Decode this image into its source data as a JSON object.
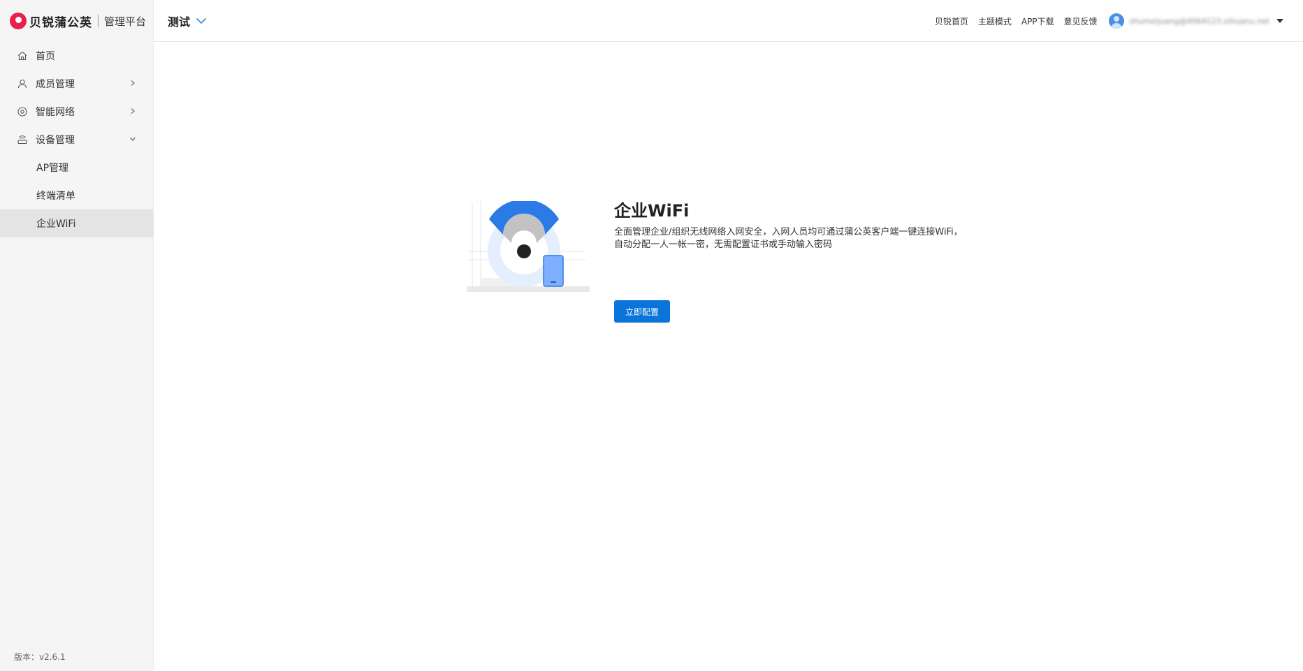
{
  "brand": {
    "name": "贝锐蒲公英",
    "subtitle": "管理平台"
  },
  "sidebar": {
    "items": [
      {
        "label": "首页",
        "icon": "home-icon"
      },
      {
        "label": "成员管理",
        "icon": "user-icon"
      },
      {
        "label": "智能网络",
        "icon": "network-icon"
      },
      {
        "label": "设备管理",
        "icon": "router-icon"
      }
    ],
    "subitems": [
      {
        "label": "AP管理"
      },
      {
        "label": "终端清单"
      },
      {
        "label": "企业WiFi",
        "active": true
      }
    ],
    "version": "版本：v2.6.1"
  },
  "header": {
    "project": "测试",
    "links": [
      "贝锐首页",
      "主题模式",
      "APP下载",
      "意见反馈"
    ],
    "user_email": "zhumeijuang@4064123.oihuanu.net"
  },
  "main": {
    "title": "企业WiFi",
    "desc_line1": "全面管理企业/组织无线网络入网安全，入网人员均可通过蒲公英客户端一键连接WiFi，",
    "desc_line2": "自动分配一人一帐一密，无需配置证书或手动输入密码",
    "cta": "立即配置"
  },
  "colors": {
    "accent": "#0a74da",
    "brand": "#e8204e",
    "sidebar_bg": "#f5f5f5",
    "active_bg": "#e4e4e4"
  }
}
